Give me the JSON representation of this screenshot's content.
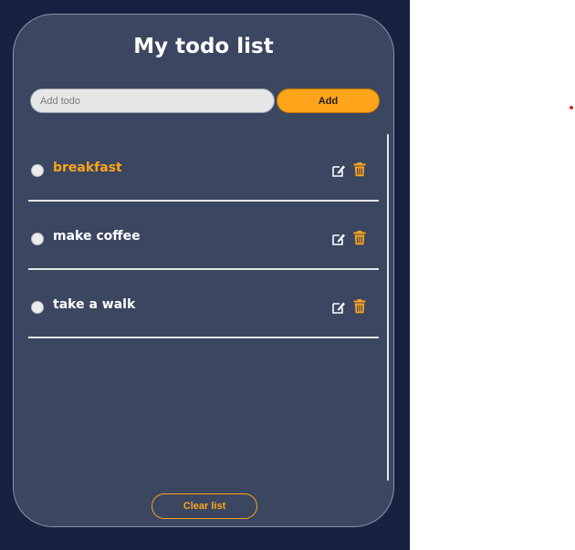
{
  "app": {
    "title": "My todo list"
  },
  "add": {
    "placeholder": "Add todo",
    "value": "",
    "button_label": "Add"
  },
  "todos": [
    {
      "text": "breakfast",
      "active": true
    },
    {
      "text": "make coffee",
      "active": false
    },
    {
      "text": "take a walk",
      "active": false
    }
  ],
  "footer": {
    "clear_label": "Clear list"
  },
  "colors": {
    "page_bg": "#162240",
    "card_bg": "#3b4660",
    "accent": "#ffa41b",
    "text": "#ffffff"
  },
  "icons": {
    "edit": "edit-icon",
    "delete": "trash-icon"
  }
}
